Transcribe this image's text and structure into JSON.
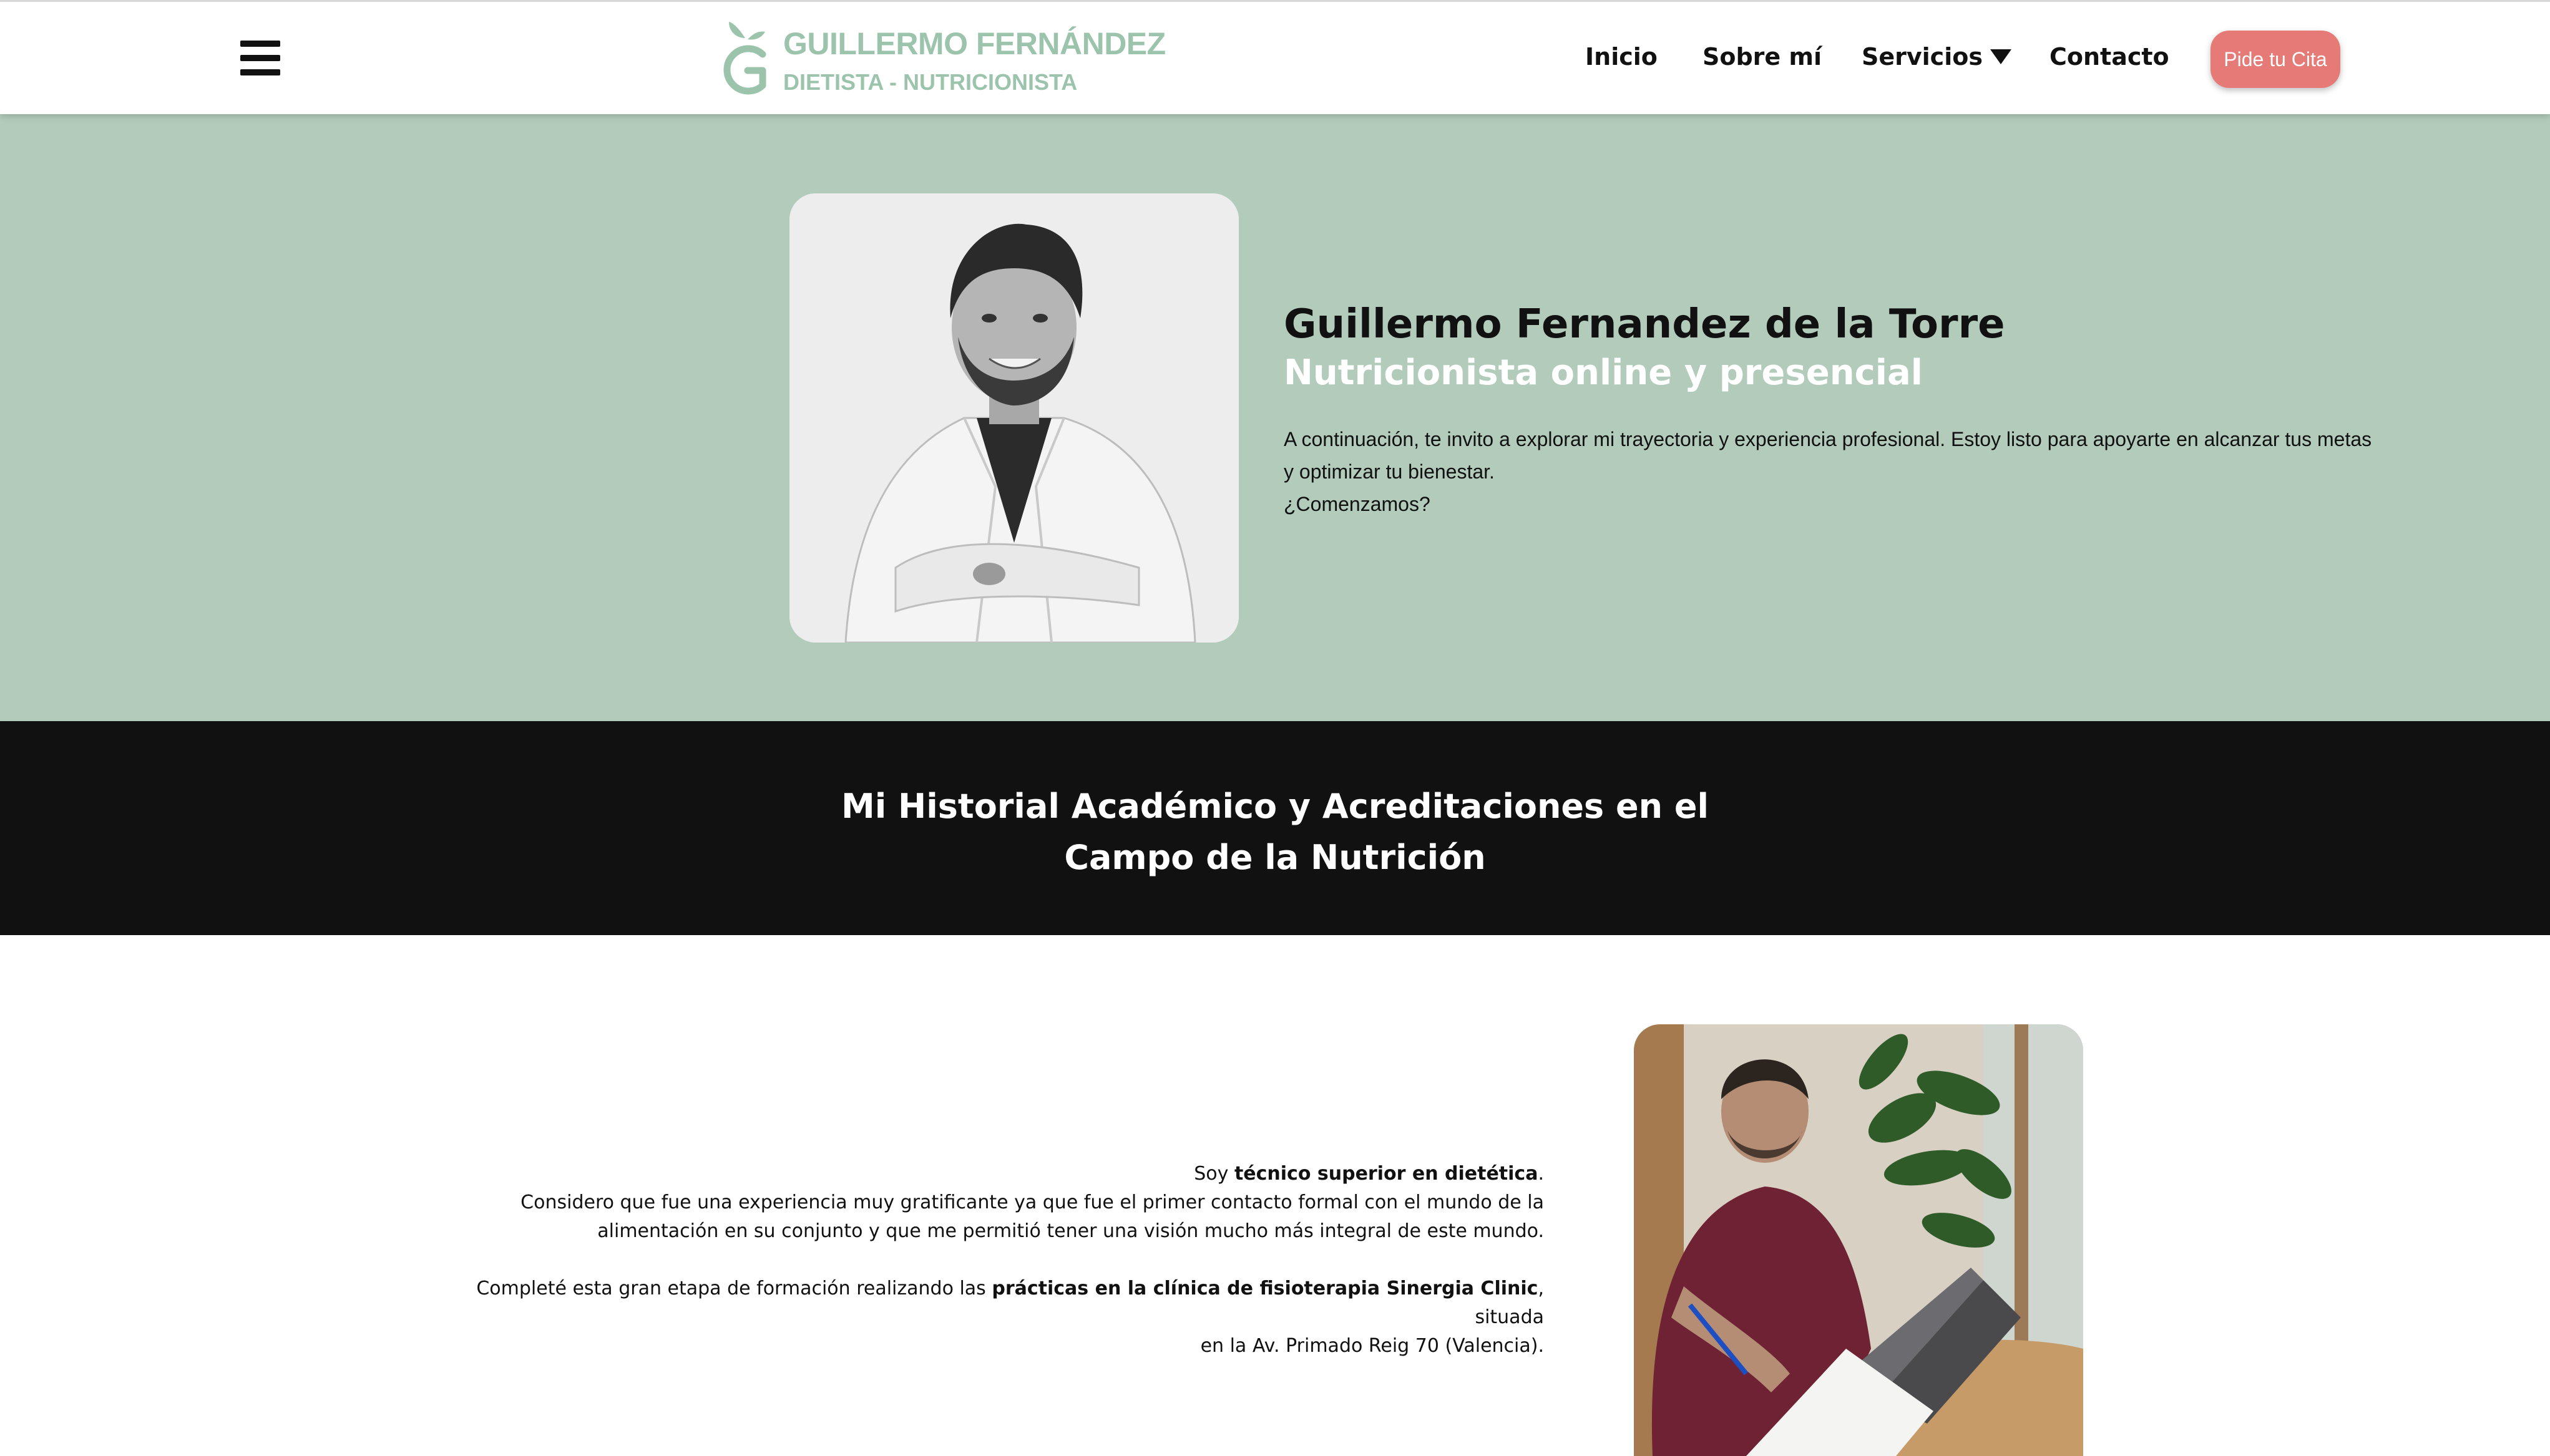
{
  "header": {
    "menu_icon": "hamburger-menu-icon",
    "logo": {
      "title": "GUILLERMO FERNÁNDEZ",
      "subtitle": "DIETISTA - NUTRICIONISTA",
      "icon": "apple-g-logo-icon",
      "color": "#9cc4ad"
    },
    "nav": {
      "inicio": "Inicio",
      "sobre": "Sobre mí",
      "servicios": "Servicios",
      "contacto": "Contacto"
    },
    "cta_label": "Pide tu Cita",
    "cta_color": "#e57a76"
  },
  "hero": {
    "background": "#b2cbbb",
    "name": "Guillermo Fernandez de la Torre",
    "role": "Nutricionista online y presencial",
    "paragraph_line1": "A continuación, te invito a explorar mi trayectoria y experiencia profesional. Estoy listo para apoyarte en alcanzar tus metas",
    "paragraph_line2": "y optimizar tu bienestar.",
    "paragraph_line3": "¿Comenzamos?"
  },
  "band": {
    "title_line1": "Mi Historial Académico y Acreditaciones en el",
    "title_line2": "Campo de la Nutrición"
  },
  "education": {
    "p1_prefix": "Soy ",
    "p1_bold": "técnico superior en dietética",
    "p1_suffix": ".",
    "p1_line2": "Considero que fue una experiencia muy gratificante ya que fue el primer contacto formal con el mundo de la",
    "p1_line3": "alimentación en su conjunto y que me permitió tener una visión mucho más integral de este mundo.",
    "p2_prefix": "Completé esta gran etapa de formación realizando las ",
    "p2_bold": "prácticas en la clínica de fisioterapia Sinergia Clinic",
    "p2_suffix": ", situada",
    "p2_line2": "en la Av. Primado Reig 70 (Valencia)."
  }
}
